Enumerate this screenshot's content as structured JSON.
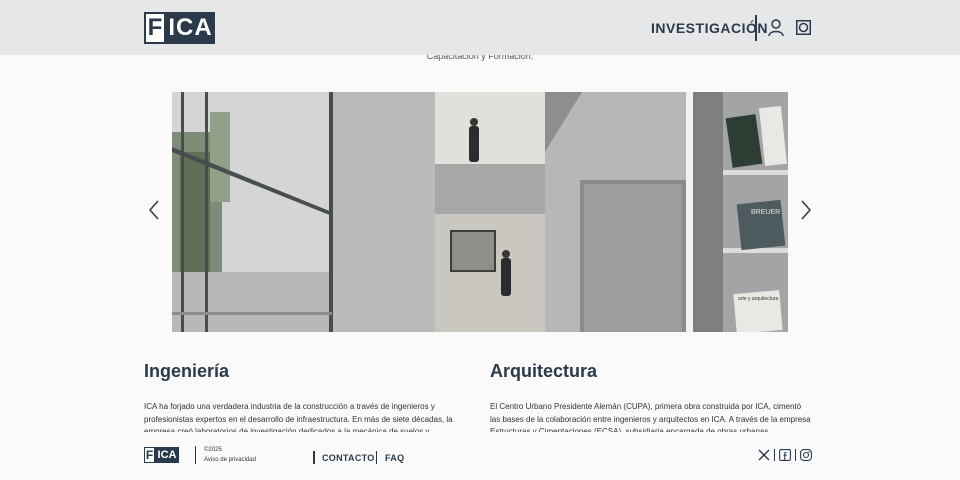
{
  "header": {
    "logo_letter": "F",
    "logo_text": "ICA",
    "nav_label": "INVESTIGACIÓN",
    "user_icon": "user-icon",
    "search_icon": "search-icon"
  },
  "top_cut_text": "Capacitación y Formación.",
  "slider": {
    "prev_icon": "chevron-left-icon",
    "next_icon": "chevron-right-icon",
    "book_labels": [
      "BREUER",
      "arte y arquitectura"
    ]
  },
  "sections": [
    {
      "title": "Ingeniería",
      "body": "ICA ha forjado una verdadera industria de la construcción a través de ingenieros y profesionistas expertos en el desarrollo de infraestructura. En más de siete décadas, la empresa creó laboratorios de investigación dedicados a la mecánica de suelos y"
    },
    {
      "title": "Arquitectura",
      "body": "El Centro Urbano Presidente Alemán (CUPA), primera obra construida por ICA, cimentó las bases de la colaboración entre ingenieros y arquitectos en ICA. A través de la empresa Estructuras y Cimentaciones (ECSA), subsidiaria encargada de obras urbanas"
    }
  ],
  "footer": {
    "logo_letter": "F",
    "logo_text": "ICA",
    "copyright": "©2025",
    "privacy": "Aviso de privacidad",
    "links": [
      "CONTACTO",
      "FAQ"
    ],
    "social_icons": [
      "x-twitter-icon",
      "facebook-icon",
      "instagram-icon"
    ]
  },
  "colors": {
    "brand_navy": "#2b3a4a",
    "header_bg": "#e6e7e9",
    "page_bg": "#fafafa"
  }
}
